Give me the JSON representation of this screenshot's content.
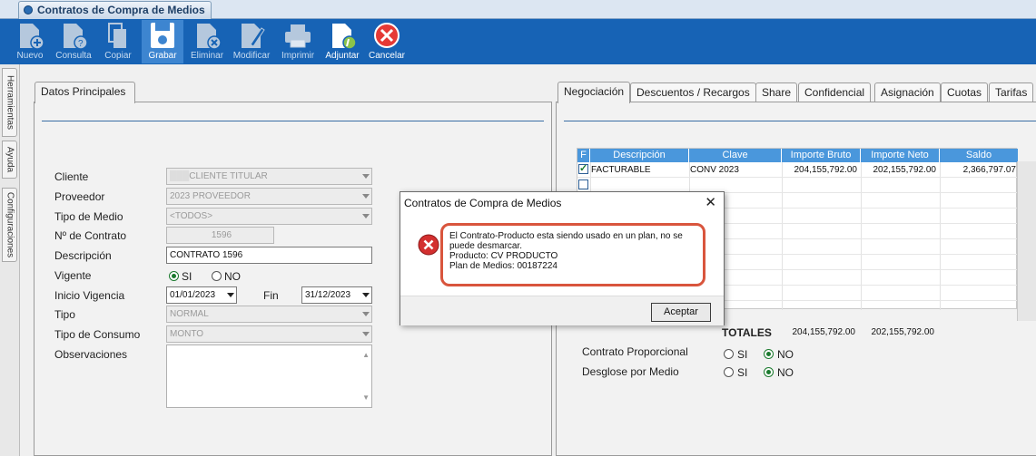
{
  "window": {
    "tab_title": "Contratos de Compra de Medios"
  },
  "toolbar": {
    "buttons": [
      {
        "label": "Nuevo",
        "icon": "new-document-icon",
        "enabled": false
      },
      {
        "label": "Consulta",
        "icon": "query-document-icon",
        "enabled": false
      },
      {
        "label": "Copiar",
        "icon": "copy-icon",
        "enabled": false
      },
      {
        "label": "Grabar",
        "icon": "save-icon",
        "enabled": true
      },
      {
        "label": "Eliminar",
        "icon": "delete-document-icon",
        "enabled": false
      },
      {
        "label": "Modificar",
        "icon": "edit-document-icon",
        "enabled": false
      },
      {
        "label": "Imprimir",
        "icon": "printer-icon",
        "enabled": false
      },
      {
        "label": "Adjuntar",
        "icon": "attach-document-icon",
        "enabled": true
      },
      {
        "label": "Cancelar",
        "icon": "cancel-icon",
        "enabled": true
      }
    ]
  },
  "side_tabs": [
    "Herramientas",
    "Ayuda",
    "Configuraciones"
  ],
  "left_panel": {
    "tab": "Datos Principales",
    "fields": {
      "cliente": {
        "label": "Cliente",
        "value": "CLIENTE TITULAR"
      },
      "proveedor": {
        "label": "Proveedor",
        "value": "2023 PROVEEDOR"
      },
      "tipo_medio": {
        "label": "Tipo de Medio",
        "value": "<TODOS>"
      },
      "numero_contrato": {
        "label": "Nº de Contrato",
        "value": "1596"
      },
      "descripcion": {
        "label": "Descripción",
        "value": "CONTRATO 1596"
      },
      "vigente": {
        "label": "Vigente",
        "option_si": "SI",
        "option_no": "NO",
        "selected": "SI"
      },
      "inicio_vigencia": {
        "label": "Inicio Vigencia",
        "value": "01/01/2023"
      },
      "fin": {
        "label": "Fin",
        "value": "31/12/2023"
      },
      "tipo": {
        "label": "Tipo",
        "value": "NORMAL"
      },
      "tipo_consumo": {
        "label": "Tipo de Consumo",
        "value": "MONTO"
      },
      "observaciones": {
        "label": "Observaciones",
        "value": ""
      }
    }
  },
  "right_panel": {
    "tabs": [
      "Negociación",
      "Descuentos / Recargos",
      "Share",
      "Confidencial",
      "Asignación",
      "Cuotas",
      "Tarifas"
    ],
    "grid": {
      "columns": [
        "F",
        "Descripción",
        "Clave",
        "Importe Bruto",
        "Importe Neto",
        "Saldo"
      ],
      "rows": [
        {
          "checked": true,
          "descripcion": "FACTURABLE",
          "clave": "CONV          2023",
          "importe_bruto": "204,155,792.00",
          "importe_neto": "202,155,792.00",
          "saldo": "2,366,797.07"
        },
        {
          "checked": false,
          "descripcion": "",
          "clave": "",
          "importe_bruto": "",
          "importe_neto": "",
          "saldo": ""
        }
      ]
    },
    "totales": {
      "label": "TOTALES",
      "bruto": "204,155,792.00",
      "neto": "202,155,792.00"
    },
    "contrato_proporcional": {
      "label": "Contrato Proporcional",
      "option_si": "SI",
      "option_no": "NO",
      "selected": "NO"
    },
    "desglose_medio": {
      "label": "Desglose por Medio",
      "option_si": "SI",
      "option_no": "NO",
      "selected": "NO"
    }
  },
  "dialog": {
    "title": "Contratos de Compra de Medios",
    "icon": "error-icon",
    "message_lines": [
      "El Contrato-Producto esta siendo usado en un plan, no se",
      "puede desmarcar.",
      "Producto: CV PRODUCTO",
      "Plan de Medios: 00187224"
    ],
    "ok_label": "Aceptar"
  },
  "colors": {
    "toolbar": "#1763b5",
    "grid_header": "#4a97dc",
    "error_outline": "#d9553d"
  }
}
